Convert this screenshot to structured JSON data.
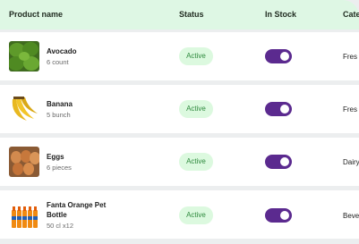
{
  "table": {
    "columns": {
      "product_name": "Product name",
      "status": "Status",
      "in_stock": "In Stock",
      "category": "Cate"
    },
    "rows": [
      {
        "name": "Avocado",
        "sub": "6 count",
        "status": "Active",
        "in_stock": true,
        "category": "Fres",
        "image": "avocado"
      },
      {
        "name": "Banana",
        "sub": "5 bunch",
        "status": "Active",
        "in_stock": true,
        "category": "Fres",
        "image": "banana"
      },
      {
        "name": "Eggs",
        "sub": "6 pieces",
        "status": "Active",
        "in_stock": true,
        "category": "Dairy",
        "image": "eggs"
      },
      {
        "name": "Fanta Orange Pet Bottle",
        "sub": "50 cl x12",
        "status": "Active",
        "in_stock": true,
        "category": "Beve",
        "image": "fanta-bottles"
      }
    ]
  },
  "colors": {
    "header_bg": "#def7e4",
    "badge_bg": "#dcf9df",
    "badge_text": "#2f8a3e",
    "toggle_on": "#5b2a8f"
  }
}
